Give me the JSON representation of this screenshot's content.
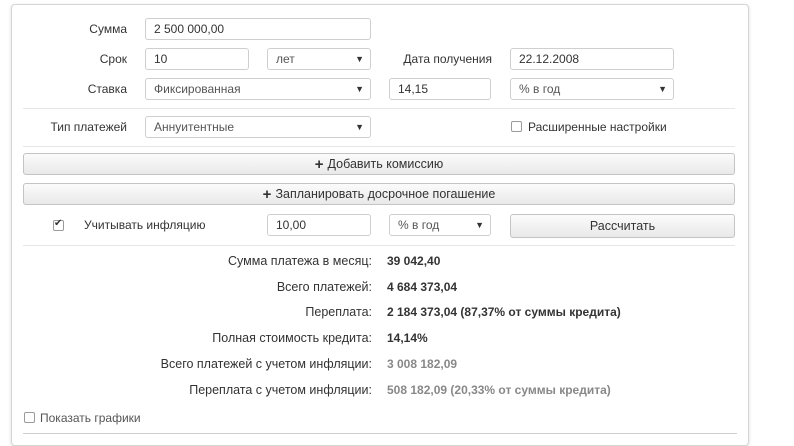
{
  "form": {
    "amount_label": "Сумма",
    "amount_value": "2 500 000,00",
    "term_label": "Срок",
    "term_value": "10",
    "term_unit": "лет",
    "date_label": "Дата получения",
    "date_value": "22.12.2008",
    "rate_label": "Ставка",
    "rate_type": "Фиксированная",
    "rate_value": "14,15",
    "rate_unit": "% в год",
    "payment_type_label": "Тип платежей",
    "payment_type": "Аннуитентные",
    "advanced_label": "Расширенные настройки",
    "advanced_checked": false
  },
  "buttons": {
    "add_commission": "Добавить комиссию",
    "plan_prepayment": "Запланировать досрочное погашение",
    "calculate": "Рассчитать"
  },
  "inflation": {
    "checked": true,
    "label": "Учитывать инфляцию",
    "value": "10,00",
    "unit": "% в год"
  },
  "results": [
    {
      "label": "Сумма платежа в месяц:",
      "value": "39 042,40",
      "muted": false
    },
    {
      "label": "Всего платежей:",
      "value": "4 684 373,04",
      "muted": false
    },
    {
      "label": "Переплата:",
      "value": "2 184 373,04 (87,37% от суммы кредита)",
      "muted": false
    },
    {
      "label": "Полная стоимость кредита:",
      "value": "14,14%",
      "muted": false
    },
    {
      "label": "Всего платежей с учетом инфляции:",
      "value": "3 008 182,09",
      "muted": true
    },
    {
      "label": "Переплата с учетом инфляции:",
      "value": "508 182,09 (20,33% от суммы кредита)",
      "muted": true
    }
  ],
  "show_charts": {
    "label": "Показать графики",
    "checked": false
  },
  "icons": {
    "dropdown": "triangle-down-icon",
    "plus": "plus-icon",
    "checkbox": "checkbox-icon"
  }
}
